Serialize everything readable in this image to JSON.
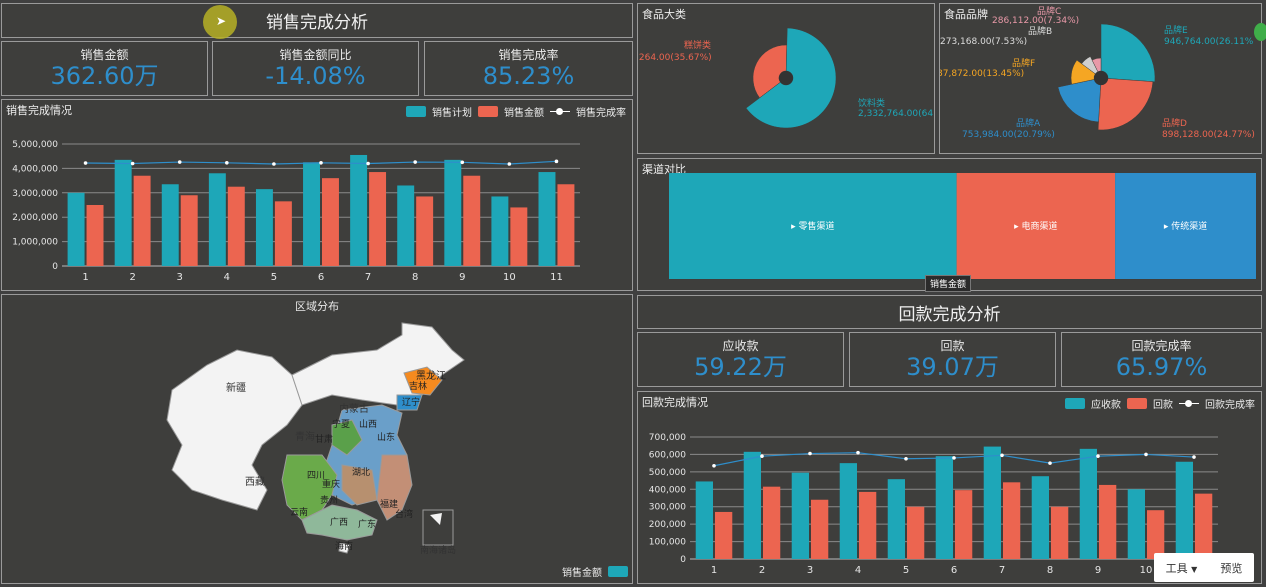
{
  "sales": {
    "title": "销售完成分析",
    "kpis": [
      {
        "label": "销售金额",
        "value": "362.60万"
      },
      {
        "label": "销售金额同比",
        "value": "-14.08%"
      },
      {
        "label": "销售完成率",
        "value": "85.23%"
      }
    ],
    "chart_title": "销售完成情况",
    "legend": [
      "销售计划",
      "销售金额",
      "销售完成率"
    ]
  },
  "payback": {
    "title": "回款完成分析",
    "kpis": [
      {
        "label": "应收款",
        "value": "59.22万"
      },
      {
        "label": "回款",
        "value": "39.07万"
      },
      {
        "label": "回款完成率",
        "value": "65.97%"
      }
    ],
    "chart_title": "回款完成情况",
    "legend": [
      "应收款",
      "回款",
      "回款完成率"
    ]
  },
  "food_category": {
    "title": "食品大类",
    "label_left": "糕饼类",
    "label_left_value": ",264.00(35.67%)",
    "label_right": "饮料类",
    "label_right_value": "2,332,764.00(64."
  },
  "food_brand": {
    "title": "食品品牌",
    "labels": [
      {
        "name": "品牌C",
        "value": "286,112.00(7.34%)"
      },
      {
        "name": "品牌B",
        "value": "273,168.00(7.53%)"
      },
      {
        "name": "品牌F",
        "value": "87,872.00(13.45%)"
      },
      {
        "name": "品牌A",
        "value": "753,984.00(20.79%)"
      },
      {
        "name": "品牌E",
        "value": "946,764.00(26.11%"
      },
      {
        "name": "品牌D",
        "value": "898,128.00(24.77%)"
      }
    ]
  },
  "channel": {
    "title": "渠道对比",
    "items": [
      "零售渠道",
      "电商渠道",
      "传统渠道"
    ],
    "tooltip": "销售金额"
  },
  "region": {
    "title": "区域分布",
    "legend": "销售金额",
    "provinces": [
      "新疆",
      "西藏",
      "内蒙古",
      "黑龙江",
      "吉林",
      "辽宁",
      "青海",
      "甘肃",
      "宁夏",
      "山西",
      "山东",
      "四川",
      "重庆",
      "湖北",
      "贵州",
      "云南",
      "广西",
      "广东",
      "福建",
      "台湾",
      "海南",
      "南海诸岛"
    ]
  },
  "toolbar": {
    "tools": "工具",
    "preview": "预览"
  },
  "colors": {
    "teal": "#1ea7b8",
    "coral": "#ec6550",
    "blue": "#2e8ecb",
    "bg": "#3e3e3c"
  },
  "chart_data": [
    {
      "type": "bar",
      "title": "销售完成情况",
      "categories": [
        "1",
        "2",
        "3",
        "4",
        "5",
        "6",
        "7",
        "8",
        "9",
        "10",
        "11"
      ],
      "ylim": [
        0,
        5000000
      ],
      "yticks": [
        "0",
        "1,000,000",
        "2,000,000",
        "3,000,000",
        "4,000,000",
        "5,000,000"
      ],
      "series": [
        {
          "name": "销售计划",
          "values": [
            3000000,
            4350000,
            3350000,
            3800000,
            3150000,
            4250000,
            4550000,
            3300000,
            4350000,
            2850000,
            3850000
          ]
        },
        {
          "name": "销售金额",
          "values": [
            2500000,
            3700000,
            2900000,
            3250000,
            2650000,
            3600000,
            3850000,
            2850000,
            3700000,
            2400000,
            3350000
          ]
        },
        {
          "name": "销售完成率",
          "values": [
            4220000,
            4200000,
            4260000,
            4230000,
            4180000,
            4230000,
            4200000,
            4260000,
            4250000,
            4180000,
            4290000
          ]
        }
      ]
    },
    {
      "type": "bar",
      "title": "回款完成情况",
      "categories": [
        "1",
        "2",
        "3",
        "4",
        "5",
        "6",
        "7",
        "8",
        "9",
        "10",
        "11"
      ],
      "ylim": [
        0,
        700000
      ],
      "yticks": [
        "0",
        "100,000",
        "200,000",
        "300,000",
        "400,000",
        "500,000",
        "600,000",
        "700,000"
      ],
      "series": [
        {
          "name": "应收款",
          "values": [
            445000,
            615000,
            495000,
            550000,
            458000,
            590000,
            645000,
            475000,
            632000,
            400000,
            558000
          ]
        },
        {
          "name": "回款",
          "values": [
            270000,
            415000,
            340000,
            385000,
            300000,
            395000,
            440000,
            300000,
            425000,
            280000,
            375000
          ]
        },
        {
          "name": "回款完成率",
          "values": [
            535000,
            590000,
            605000,
            610000,
            575000,
            580000,
            595000,
            550000,
            590000,
            600000,
            585000
          ]
        }
      ]
    },
    {
      "type": "pie",
      "title": "食品大类",
      "categories": [
        "糕饼类",
        "饮料类"
      ],
      "values": [
        35.67,
        64.33
      ]
    },
    {
      "type": "pie",
      "title": "食品品牌",
      "categories": [
        "品牌E",
        "品牌D",
        "品牌A",
        "品牌F",
        "品牌B",
        "品牌C"
      ],
      "values": [
        26.11,
        24.77,
        20.79,
        13.45,
        7.53,
        7.34
      ]
    },
    {
      "type": "bar",
      "title": "渠道对比",
      "categories": [
        "零售渠道",
        "电商渠道",
        "传统渠道"
      ],
      "values": [
        0.49,
        0.27,
        0.24
      ]
    }
  ]
}
